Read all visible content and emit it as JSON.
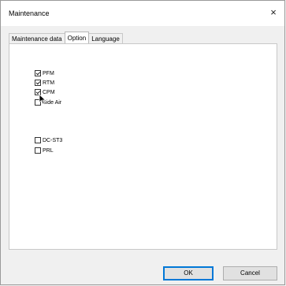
{
  "window": {
    "title": "Maintenance",
    "close_glyph": "×"
  },
  "tabs": [
    {
      "label": "Maintenance data",
      "active": false
    },
    {
      "label": "Option",
      "active": true
    },
    {
      "label": "Language",
      "active": false
    }
  ],
  "options": [
    {
      "label": "PFM",
      "checked": true
    },
    {
      "label": "RTM",
      "checked": true
    },
    {
      "label": "CPM",
      "checked": true
    },
    {
      "label": "Side Air",
      "checked": false
    },
    {
      "label": "DC-ST3",
      "checked": false
    },
    {
      "label": "PRL",
      "checked": false
    }
  ],
  "buttons": {
    "ok": "OK",
    "cancel": "Cancel"
  },
  "icons": {
    "close": "close-icon",
    "cursor": "mouse-pointer-icon"
  }
}
